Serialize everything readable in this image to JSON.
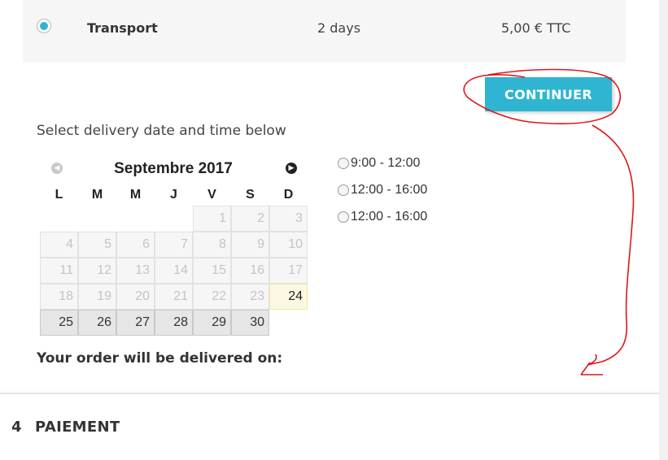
{
  "carrier": {
    "name": "Transport",
    "delay": "2 days",
    "price": "5,00 € TTC",
    "selected": true
  },
  "continue_label": "CONTINUER",
  "delivery": {
    "prompt": "Select delivery date and time below",
    "result_label": "Your order will be delivered on:"
  },
  "calendar": {
    "month_title": "Septembre 2017",
    "prev_icon": "prev-month-icon",
    "next_icon": "next-month-icon",
    "weekdays": [
      "L",
      "M",
      "M",
      "J",
      "V",
      "S",
      "D"
    ],
    "leading_empty": 4,
    "days": [
      {
        "n": "1",
        "state": "disabled"
      },
      {
        "n": "2",
        "state": "disabled"
      },
      {
        "n": "3",
        "state": "disabled"
      },
      {
        "n": "4",
        "state": "disabled"
      },
      {
        "n": "5",
        "state": "disabled"
      },
      {
        "n": "6",
        "state": "disabled"
      },
      {
        "n": "7",
        "state": "disabled"
      },
      {
        "n": "8",
        "state": "disabled"
      },
      {
        "n": "9",
        "state": "disabled"
      },
      {
        "n": "10",
        "state": "disabled"
      },
      {
        "n": "11",
        "state": "disabled"
      },
      {
        "n": "12",
        "state": "disabled"
      },
      {
        "n": "13",
        "state": "disabled"
      },
      {
        "n": "14",
        "state": "disabled"
      },
      {
        "n": "15",
        "state": "disabled"
      },
      {
        "n": "16",
        "state": "disabled"
      },
      {
        "n": "17",
        "state": "disabled"
      },
      {
        "n": "18",
        "state": "disabled"
      },
      {
        "n": "19",
        "state": "disabled"
      },
      {
        "n": "20",
        "state": "disabled"
      },
      {
        "n": "21",
        "state": "disabled"
      },
      {
        "n": "22",
        "state": "disabled"
      },
      {
        "n": "23",
        "state": "disabled"
      },
      {
        "n": "24",
        "state": "today"
      },
      {
        "n": "25",
        "state": "active"
      },
      {
        "n": "26",
        "state": "active"
      },
      {
        "n": "27",
        "state": "active"
      },
      {
        "n": "28",
        "state": "active"
      },
      {
        "n": "29",
        "state": "active"
      },
      {
        "n": "30",
        "state": "active"
      }
    ]
  },
  "time_slots": [
    "9:00 - 12:00",
    "12:00 - 16:00",
    "12:00 - 16:00"
  ],
  "next_step": {
    "number": "4",
    "title": "PAIEMENT"
  },
  "colors": {
    "accent": "#2fb5d2",
    "annotation": "#e0161b"
  }
}
